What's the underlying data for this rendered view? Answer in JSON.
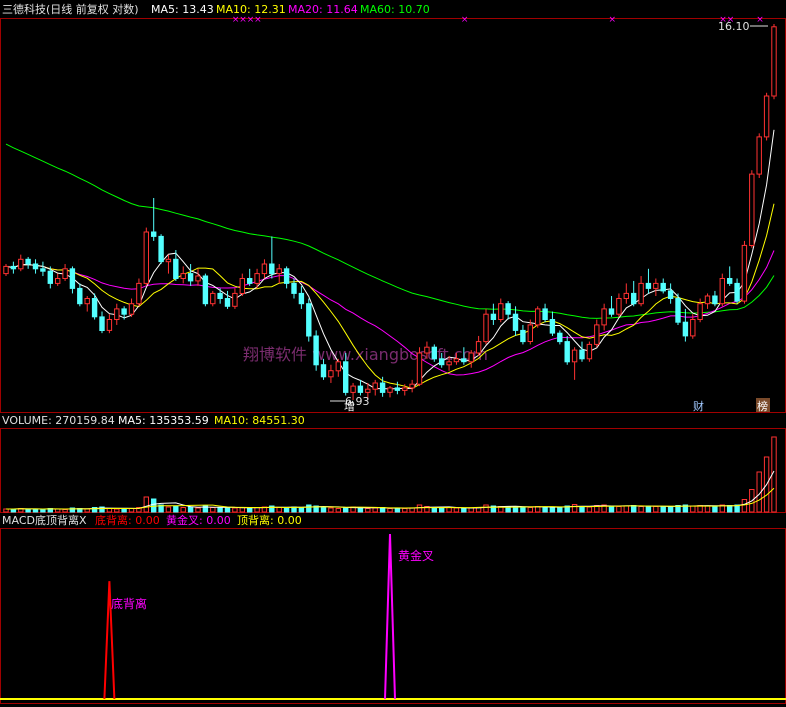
{
  "colors": {
    "background": "#000000",
    "border": "#a00000",
    "up": "#ff3232",
    "down": "#54ffff",
    "ma5": "#ffffff",
    "ma10": "#ffff00",
    "ma20": "#ff00ff",
    "ma60": "#00ff00",
    "signal_mark": "#ff00ff",
    "bottom_divergence": "#ff0000",
    "golden_cross": "#ff00ff",
    "top_divergence": "#ffff00",
    "watermark": "#7a2c6e"
  },
  "header": {
    "title": "三德科技(日线 前复权 对数)",
    "ma5": "MA5: 13.43",
    "ma10": "MA10: 12.31",
    "ma20": "MA20: 11.64",
    "ma60": "MA60: 10.70"
  },
  "volume_header": {
    "title": "VOLUME: 270159.84",
    "ma5": "MA5: 135353.59",
    "ma10": "MA10: 84551.30"
  },
  "macd_header": {
    "title": "MACD底顶背离X",
    "bottom": "底背离: 0.00",
    "golden": "黄金叉: 0.00",
    "top": "顶背离: 0.00"
  },
  "annotations": {
    "high_price": "16.10",
    "low_price": "6.93",
    "marker_zeng": "增",
    "marker_cai": "财",
    "marker_bang": "榜",
    "watermark": "翔博软件 www.xiangbosoft.com",
    "signal_bottom": "底背离",
    "signal_golden": "黄金叉"
  },
  "chart_data": [
    {
      "type": "candlestick",
      "title": "三德科技(日线 前复权 对数)",
      "scale": "log",
      "ylim": [
        6.93,
        16.1
      ],
      "candles": [
        [
          9.2,
          9.4,
          9.15,
          9.35
        ],
        [
          9.35,
          9.45,
          9.2,
          9.3
        ],
        [
          9.3,
          9.6,
          9.25,
          9.5
        ],
        [
          9.5,
          9.55,
          9.3,
          9.4
        ],
        [
          9.4,
          9.5,
          9.2,
          9.3
        ],
        [
          9.3,
          9.45,
          9.15,
          9.25
        ],
        [
          9.25,
          9.35,
          8.9,
          9.0
        ],
        [
          9.0,
          9.2,
          8.95,
          9.1
        ],
        [
          9.1,
          9.4,
          9.05,
          9.3
        ],
        [
          9.3,
          9.35,
          8.8,
          8.9
        ],
        [
          8.9,
          9.0,
          8.55,
          8.6
        ],
        [
          8.6,
          8.75,
          8.45,
          8.7
        ],
        [
          8.7,
          8.8,
          8.3,
          8.35
        ],
        [
          8.35,
          8.45,
          8.05,
          8.1
        ],
        [
          8.1,
          8.4,
          8.05,
          8.3
        ],
        [
          8.3,
          8.6,
          8.2,
          8.5
        ],
        [
          8.5,
          8.55,
          8.3,
          8.4
        ],
        [
          8.4,
          8.7,
          8.35,
          8.6
        ],
        [
          8.6,
          9.1,
          8.55,
          9.0
        ],
        [
          9.0,
          10.2,
          8.95,
          10.1
        ],
        [
          10.1,
          10.9,
          9.9,
          10.0
        ],
        [
          10.0,
          10.05,
          9.4,
          9.45
        ],
        [
          9.45,
          9.6,
          9.2,
          9.5
        ],
        [
          9.5,
          9.7,
          9.05,
          9.1
        ],
        [
          9.1,
          9.35,
          9.0,
          9.2
        ],
        [
          9.2,
          9.4,
          8.95,
          9.05
        ],
        [
          9.05,
          9.3,
          8.95,
          9.15
        ],
        [
          9.15,
          9.2,
          8.55,
          8.6
        ],
        [
          8.6,
          8.85,
          8.55,
          8.8
        ],
        [
          8.8,
          8.9,
          8.6,
          8.7
        ],
        [
          8.7,
          8.85,
          8.5,
          8.55
        ],
        [
          8.55,
          8.9,
          8.5,
          8.8
        ],
        [
          8.8,
          9.2,
          8.75,
          9.1
        ],
        [
          9.1,
          9.3,
          8.95,
          9.0
        ],
        [
          9.0,
          9.3,
          8.9,
          9.2
        ],
        [
          9.2,
          9.5,
          9.1,
          9.4
        ],
        [
          9.4,
          10.0,
          9.1,
          9.2
        ],
        [
          9.2,
          9.4,
          9.0,
          9.3
        ],
        [
          9.3,
          9.35,
          8.9,
          9.0
        ],
        [
          9.0,
          9.1,
          8.7,
          8.8
        ],
        [
          8.8,
          8.95,
          8.5,
          8.6
        ],
        [
          8.6,
          8.7,
          7.9,
          8.0
        ],
        [
          8.0,
          8.1,
          7.4,
          7.5
        ],
        [
          7.5,
          7.6,
          7.25,
          7.3
        ],
        [
          7.3,
          7.5,
          7.2,
          7.4
        ],
        [
          7.4,
          7.6,
          7.3,
          7.55
        ],
        [
          7.55,
          7.7,
          7.0,
          7.05
        ],
        [
          7.05,
          7.2,
          6.93,
          7.15
        ],
        [
          7.15,
          7.25,
          7.0,
          7.05
        ],
        [
          7.05,
          7.2,
          6.95,
          7.1
        ],
        [
          7.1,
          7.25,
          7.0,
          7.2
        ],
        [
          7.2,
          7.3,
          6.98,
          7.05
        ],
        [
          7.05,
          7.15,
          6.97,
          7.12
        ],
        [
          7.12,
          7.22,
          7.02,
          7.08
        ],
        [
          7.08,
          7.18,
          7.0,
          7.12
        ],
        [
          7.12,
          7.25,
          7.05,
          7.18
        ],
        [
          7.18,
          7.8,
          7.15,
          7.7
        ],
        [
          7.7,
          7.9,
          7.6,
          7.8
        ],
        [
          7.8,
          7.85,
          7.55,
          7.6
        ],
        [
          7.6,
          7.7,
          7.45,
          7.5
        ],
        [
          7.5,
          7.65,
          7.4,
          7.55
        ],
        [
          7.55,
          7.7,
          7.5,
          7.6
        ],
        [
          7.6,
          7.8,
          7.5,
          7.55
        ],
        [
          7.55,
          7.75,
          7.45,
          7.7
        ],
        [
          7.7,
          8.0,
          7.65,
          7.9
        ],
        [
          7.9,
          8.5,
          7.85,
          8.4
        ],
        [
          8.4,
          8.6,
          8.2,
          8.3
        ],
        [
          8.3,
          8.7,
          8.25,
          8.6
        ],
        [
          8.6,
          8.65,
          8.3,
          8.4
        ],
        [
          8.4,
          8.55,
          8.0,
          8.1
        ],
        [
          8.1,
          8.2,
          7.85,
          7.9
        ],
        [
          7.9,
          8.3,
          7.85,
          8.2
        ],
        [
          8.2,
          8.55,
          8.15,
          8.5
        ],
        [
          8.5,
          8.6,
          8.25,
          8.3
        ],
        [
          8.3,
          8.45,
          8.0,
          8.05
        ],
        [
          8.05,
          8.1,
          7.85,
          7.9
        ],
        [
          7.9,
          8.0,
          7.5,
          7.55
        ],
        [
          7.55,
          7.8,
          7.25,
          7.75
        ],
        [
          7.75,
          7.9,
          7.55,
          7.6
        ],
        [
          7.6,
          7.9,
          7.55,
          7.85
        ],
        [
          7.85,
          8.3,
          7.8,
          8.2
        ],
        [
          8.2,
          8.6,
          8.1,
          8.5
        ],
        [
          8.5,
          8.75,
          8.35,
          8.4
        ],
        [
          8.4,
          8.8,
          8.35,
          8.7
        ],
        [
          8.7,
          9.0,
          8.6,
          8.8
        ],
        [
          8.8,
          9.05,
          8.55,
          8.6
        ],
        [
          8.6,
          9.15,
          8.55,
          9.0
        ],
        [
          9.0,
          9.3,
          8.8,
          8.9
        ],
        [
          8.9,
          9.1,
          8.75,
          9.0
        ],
        [
          9.0,
          9.1,
          8.8,
          8.85
        ],
        [
          8.85,
          9.0,
          8.6,
          8.7
        ],
        [
          8.7,
          8.8,
          8.2,
          8.25
        ],
        [
          8.25,
          8.5,
          7.9,
          8.0
        ],
        [
          8.0,
          8.4,
          7.95,
          8.3
        ],
        [
          8.3,
          8.7,
          8.25,
          8.6
        ],
        [
          8.6,
          8.8,
          8.5,
          8.75
        ],
        [
          8.75,
          8.85,
          8.55,
          8.6
        ],
        [
          8.6,
          9.2,
          8.55,
          9.1
        ],
        [
          9.1,
          9.35,
          8.95,
          9.0
        ],
        [
          9.0,
          9.1,
          8.6,
          8.65
        ],
        [
          8.65,
          9.9,
          8.6,
          9.8
        ],
        [
          9.8,
          11.6,
          9.75,
          11.5
        ],
        [
          11.5,
          12.6,
          11.4,
          12.5
        ],
        [
          12.5,
          13.8,
          12.4,
          13.7
        ],
        [
          13.7,
          16.1,
          13.6,
          16.0
        ]
      ],
      "ma_lines": {
        "MA5": 13.43,
        "MA10": 12.31,
        "MA20": 11.64,
        "MA60": 10.7
      },
      "signal_marks_at_bar": [
        31,
        32,
        33,
        34,
        62,
        82,
        97,
        98,
        102,
        107,
        108
      ]
    },
    {
      "type": "bar",
      "title": "VOLUME",
      "values": [
        6,
        6,
        7,
        6,
        6,
        5,
        7,
        6,
        5,
        8,
        7,
        6,
        9,
        10,
        7,
        6,
        6,
        7,
        9,
        30,
        26,
        14,
        10,
        11,
        9,
        10,
        8,
        12,
        9,
        8,
        9,
        8,
        9,
        8,
        9,
        10,
        12,
        9,
        8,
        10,
        9,
        14,
        12,
        10,
        8,
        7,
        9,
        10,
        8,
        7,
        8,
        9,
        7,
        8,
        7,
        8,
        14,
        11,
        9,
        8,
        9,
        8,
        7,
        8,
        9,
        14,
        12,
        11,
        10,
        11,
        10,
        9,
        11,
        10,
        9,
        10,
        12,
        15,
        11,
        10,
        13,
        14,
        12,
        11,
        12,
        13,
        11,
        12,
        11,
        10,
        11,
        13,
        14,
        12,
        13,
        12,
        11,
        14,
        13,
        14,
        25,
        45,
        80,
        110,
        150
      ],
      "ylim": [
        0,
        160
      ],
      "ma5": 135353.59,
      "ma10": 84551.3,
      "latest": 270159.84
    },
    {
      "type": "line",
      "title": "MACD底顶背离X",
      "series": [
        {
          "name": "底背离",
          "spike_at_bar": 14,
          "value": 1
        },
        {
          "name": "黄金叉",
          "spike_at_bar": 52,
          "value": 1.4
        },
        {
          "name": "顶背离",
          "value": 0
        }
      ],
      "latest_values": {
        "底背离": 0.0,
        "黄金叉": 0.0,
        "顶背离": 0.0
      }
    }
  ]
}
